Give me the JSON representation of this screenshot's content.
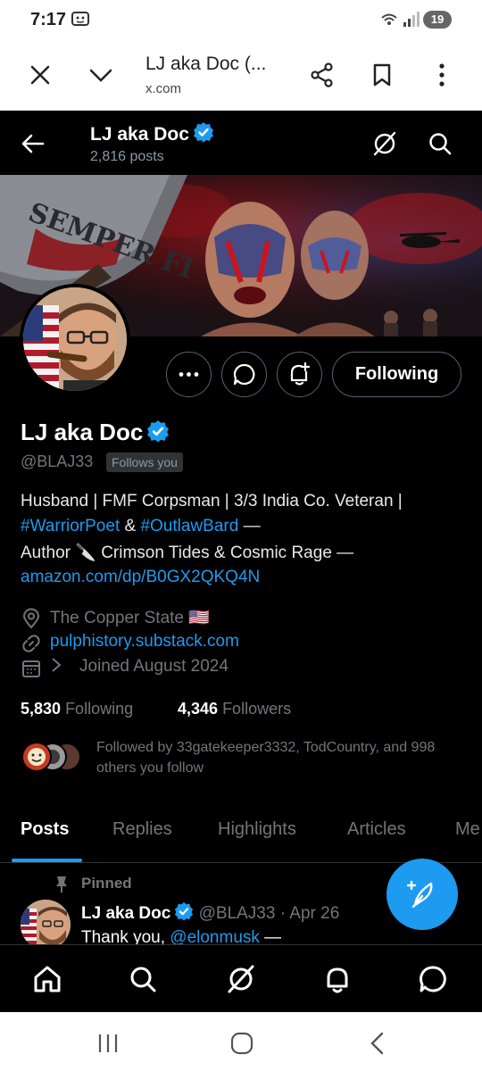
{
  "status_bar": {
    "time": "7:17",
    "battery": "19"
  },
  "browser": {
    "title": "LJ aka Doc (...",
    "url": "x.com"
  },
  "header": {
    "name": "LJ aka Doc",
    "post_count": "2,816 posts"
  },
  "banner": {
    "axe_text": "SEMPER FI"
  },
  "actions": {
    "follow_label": "Following"
  },
  "profile": {
    "name": "LJ aka Doc",
    "handle": "@BLAJ33",
    "follows_you": "Follows you",
    "bio_line1": "Husband | FMF Corpsman | 3/3 India Co. Veteran |",
    "bio_hashtag1": "#WarriorPoet",
    "bio_amp": " & ",
    "bio_hashtag2": "#OutlawBard",
    "bio_dash": " —",
    "bio_line3": "Author 🔪 Crimson Tides & Cosmic Rage —",
    "bio_link": "amazon.com/dp/B0GX2QKQ4N",
    "location": "The Copper State 🇺🇸",
    "website": "pulphistory.substack.com",
    "joined": "Joined August 2024",
    "following_count": "5,830",
    "following_label": "Following",
    "followers_count": "4,346",
    "followers_label": "Followers",
    "followed_by": "Followed by 33gatekeeper3332, TodCountry, and 998 others you follow"
  },
  "tabs": [
    {
      "label": "Posts"
    },
    {
      "label": "Replies"
    },
    {
      "label": "Highlights"
    },
    {
      "label": "Articles"
    },
    {
      "label": "Me"
    }
  ],
  "pinned_post": {
    "pinned_label": "Pinned",
    "author": "LJ aka Doc",
    "handle_date": "@BLAJ33 · Apr 26",
    "text_start": "Thank you, ",
    "mention": "@elonmusk",
    "text_end": " —"
  },
  "colors": {
    "accent": "#1d9bf0",
    "background": "#000000",
    "secondary_text": "#71767b"
  }
}
